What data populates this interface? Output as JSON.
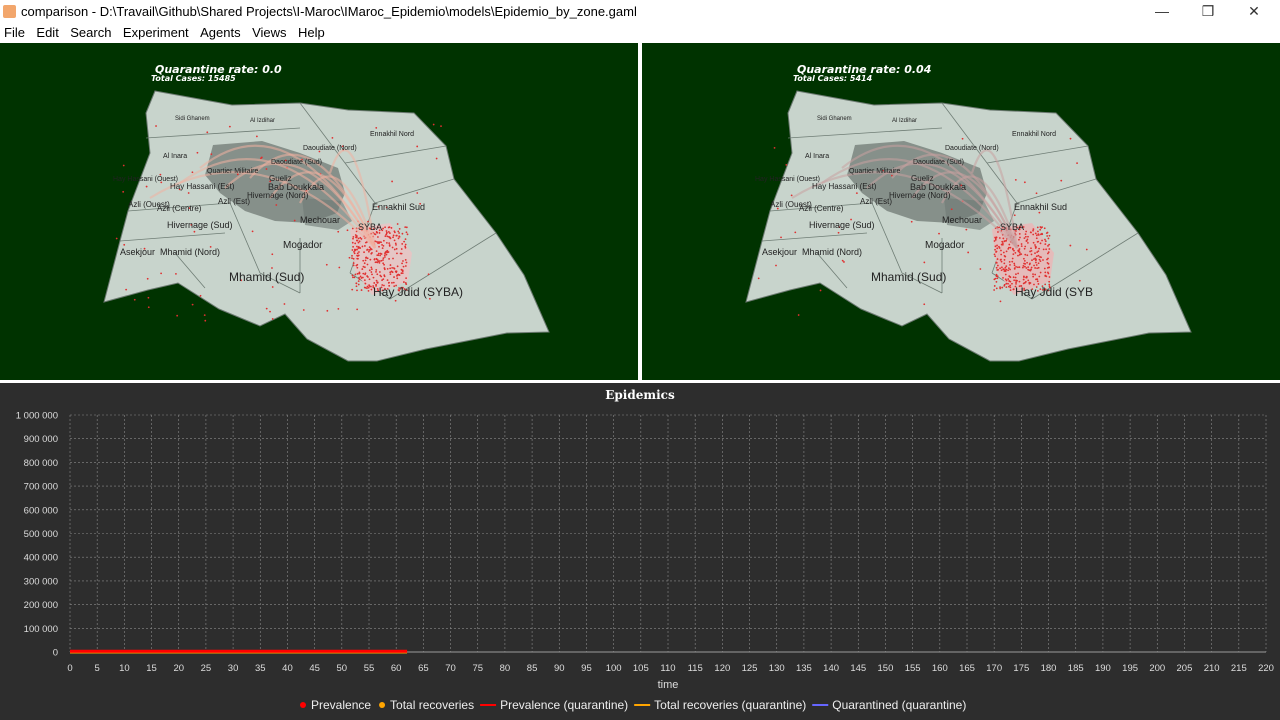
{
  "window": {
    "title": "comparison - D:\\Travail\\Github\\Shared Projects\\I-Maroc\\IMaroc_Epidemio\\models\\Epidemio_by_zone.gaml",
    "minimize": "—",
    "restore": "❒",
    "close": "✕"
  },
  "menu": [
    "File",
    "Edit",
    "Search",
    "Experiment",
    "Agents",
    "Views",
    "Help"
  ],
  "colors": {
    "map_background": "#003300",
    "zone_fill": "#c8d4cc",
    "zone_dark": "#707a74",
    "infected": "#e03030",
    "chart_background": "#2d2d2d",
    "grid": "#8a8a8a",
    "prevalence": "#ff0000",
    "total_recoveries": "#ffa500",
    "quarantined": "#6666ff"
  },
  "displays": [
    {
      "title": "Quarantine rate: 0.0",
      "subtitle": "Total Cases: 15485",
      "syba_label": "Hay Jdid (SYBA)"
    },
    {
      "title": "Quarantine rate: 0.04",
      "subtitle": "Total Cases: 5414",
      "syba_label": "Hay Jdid (SYB"
    }
  ],
  "zones": [
    "Ennakhil Nord",
    "Daoudiate (Nord)",
    "Al Izdihar",
    "Sidi Ghanem",
    "Al Inara",
    "Quartier Militaire",
    "Daoudiate (Sud)",
    "Hay Hassani (Ouest)",
    "Hay Hassani (Est)",
    "Gueliz",
    "Bab Doukkala",
    "Azli (Ouest)",
    "Azli (Centre)",
    "Azli (Est)",
    "Hivernage (Nord)",
    "Mechouar",
    "Ennakhil Sud",
    "SYBA",
    "Hivernage (Sud)",
    "Mogador",
    "Asekjour",
    "Mhamid (Nord)",
    "Mhamid (Sud)"
  ],
  "chart_data": {
    "type": "line",
    "title": "Epidemics",
    "xlabel": "time",
    "ylabel": "",
    "xlim": [
      0,
      220
    ],
    "ylim": [
      0,
      1000000
    ],
    "x_ticks": [
      "0",
      "5",
      "10",
      "15",
      "20",
      "25",
      "30",
      "35",
      "40",
      "45",
      "50",
      "55",
      "60",
      "65",
      "70",
      "75",
      "80",
      "85",
      "90",
      "95",
      "100",
      "105",
      "110",
      "115",
      "120",
      "125",
      "130",
      "135",
      "140",
      "145",
      "150",
      "155",
      "160",
      "165",
      "170",
      "175",
      "180",
      "185",
      "190",
      "195",
      "200",
      "205",
      "210",
      "215",
      "220"
    ],
    "y_ticks": [
      {
        "value": 1000000,
        "label": "1 000 000"
      },
      {
        "value": 900000,
        "label": "900 000"
      },
      {
        "value": 800000,
        "label": "800 000"
      },
      {
        "value": 700000,
        "label": "700 000"
      },
      {
        "value": 600000,
        "label": "600 000"
      },
      {
        "value": 500000,
        "label": "500 000"
      },
      {
        "value": 400000,
        "label": "400 000"
      },
      {
        "value": 300000,
        "label": "300 000"
      },
      {
        "value": 200000,
        "label": "200 000"
      },
      {
        "value": 100000,
        "label": "100 000"
      },
      {
        "value": 0,
        "label": "0"
      }
    ],
    "grid": true,
    "legend_position": "bottom",
    "series": [
      {
        "name": "Prevalence",
        "style": "marker",
        "color": "#ff0000",
        "x": [
          0,
          62
        ],
        "values": [
          3000,
          3000
        ]
      },
      {
        "name": "Total recoveries",
        "style": "marker",
        "color": "#ffa500",
        "x": [
          0,
          62
        ],
        "values": [
          0,
          0
        ]
      },
      {
        "name": "Prevalence (quarantine)",
        "style": "line",
        "color": "#ff0000",
        "x": [
          0,
          62
        ],
        "values": [
          2000,
          2000
        ]
      },
      {
        "name": "Total recoveries (quarantine)",
        "style": "line",
        "color": "#ffa500",
        "x": [
          0,
          62
        ],
        "values": [
          0,
          0
        ]
      },
      {
        "name": "Quarantined (quarantine)",
        "style": "line",
        "color": "#6666ff",
        "x": [
          0,
          62
        ],
        "values": [
          0,
          0
        ]
      }
    ]
  }
}
